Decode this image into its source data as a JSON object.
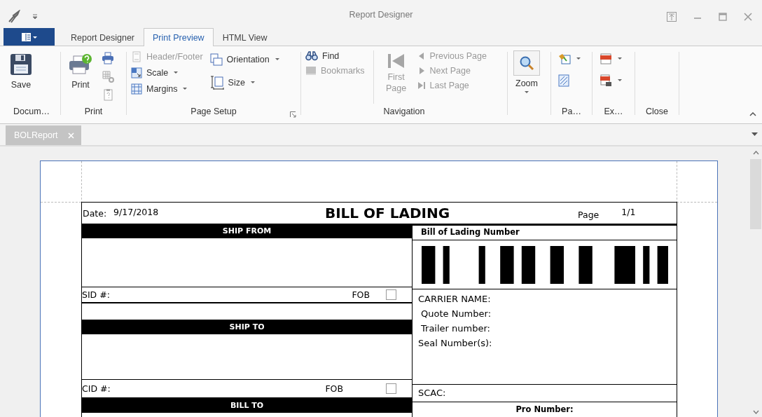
{
  "window": {
    "title": "Report Designer"
  },
  "tabs": [
    {
      "label": "Report Designer",
      "selected": false
    },
    {
      "label": "Print Preview",
      "selected": true
    },
    {
      "label": "HTML View",
      "selected": false
    }
  ],
  "ribbon": {
    "groups": [
      {
        "label": "Docum…",
        "items": [
          {
            "label": "Save",
            "disabled": false
          }
        ]
      },
      {
        "label": "Print",
        "items": [
          {
            "label": "Print",
            "disabled": false
          }
        ]
      },
      {
        "label": "Page Setup",
        "items": [
          {
            "label": "Header/Footer",
            "disabled": true,
            "has_menu": false
          },
          {
            "label": "Scale",
            "disabled": false,
            "has_menu": true
          },
          {
            "label": "Margins",
            "disabled": false,
            "has_menu": true
          },
          {
            "label": "Orientation",
            "disabled": false,
            "has_menu": true
          },
          {
            "label": "Size",
            "disabled": false,
            "has_menu": true
          }
        ]
      },
      {
        "label": "Navigation",
        "items": [
          {
            "label": "Find",
            "disabled": false
          },
          {
            "label": "Bookmarks",
            "disabled": true
          },
          {
            "label": "First Page",
            "disabled": true
          },
          {
            "label": "Previous Page",
            "disabled": true
          },
          {
            "label": "Next Page",
            "disabled": true
          },
          {
            "label": "Last Page",
            "disabled": true
          }
        ]
      },
      {
        "items": [
          {
            "label": "Zoom",
            "disabled": false,
            "has_menu": true
          }
        ]
      },
      {
        "label": "Pa…"
      },
      {
        "label": "Ex…"
      },
      {
        "label": "Close"
      }
    ]
  },
  "document_tabs": [
    {
      "label": "BOLReport",
      "selected": true
    }
  ],
  "form": {
    "date_label": "Date:",
    "date": "9/17/2018",
    "title": "BILL OF LADING",
    "page_label": "Page",
    "page": "1/1",
    "ship_from": {
      "header": "SHIP FROM",
      "id_label": "SID #:",
      "fob_label": "FOB",
      "fob_checked": false
    },
    "ship_to": {
      "header": "SHIP TO",
      "id_label": "CID #:",
      "fob_label": "FOB",
      "fob_checked": false
    },
    "bill_to": {
      "header": "BILL TO"
    },
    "bol_number_label": "Bill of Lading Number",
    "carrier_fields": [
      "CARRIER NAME:",
      "Quote Number:",
      "Trailer number:",
      "Seal Number(s):"
    ],
    "scac_label": "SCAC:",
    "pro_number_label": "Pro Number:"
  }
}
